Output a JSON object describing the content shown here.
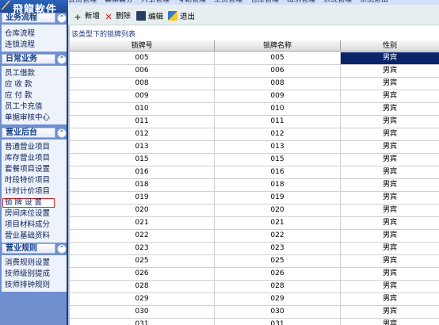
{
  "app": {
    "logo_text": "飛龍軟件"
  },
  "menubar": {
    "items": [
      "会员管理",
      "套票套券",
      "人事管理",
      "考勤管理",
      "工资管理",
      "仓库管理",
      "出纳管理",
      "系统管理",
      "系统退出"
    ]
  },
  "sidebar": {
    "groups": [
      {
        "title": "业务流程",
        "toggle": "⌃",
        "items": [
          "仓库流程",
          "连锁流程"
        ]
      },
      {
        "title": "日常业务",
        "toggle": "⌃",
        "items": [
          "员工借款",
          "应 收 款",
          "应 付 款",
          "员工卡充值",
          "单据审核中心"
        ]
      },
      {
        "title": "营业后台",
        "toggle": "⌃",
        "items": [
          "普通营业项目",
          "库存营业项目",
          "套餐项目设置",
          "时段特价项目",
          "计时计价项目",
          "锁 牌 设 置",
          "房间床位设置",
          "项目材料成分",
          "营业基础资料"
        ]
      },
      {
        "title": "营业规则",
        "toggle": "⌃",
        "items": [
          "消费规则设置",
          "技师级别提成",
          "技师排钟规则"
        ]
      }
    ],
    "selected_item": "锁 牌 设 置"
  },
  "toolbar": {
    "add_label": "新增",
    "delete_label": "删除",
    "edit_label": "编辑",
    "exit_label": "退出"
  },
  "table": {
    "caption": "该类型下的锁牌列表",
    "columns": [
      "锁牌号",
      "锁牌名称",
      "性别"
    ],
    "rows": [
      [
        "005",
        "005",
        "男宾"
      ],
      [
        "006",
        "006",
        "男宾"
      ],
      [
        "008",
        "008",
        "男宾"
      ],
      [
        "009",
        "009",
        "男宾"
      ],
      [
        "010",
        "010",
        "男宾"
      ],
      [
        "011",
        "011",
        "男宾"
      ],
      [
        "012",
        "012",
        "男宾"
      ],
      [
        "013",
        "013",
        "男宾"
      ],
      [
        "015",
        "015",
        "男宾"
      ],
      [
        "016",
        "016",
        "男宾"
      ],
      [
        "018",
        "018",
        "男宾"
      ],
      [
        "019",
        "019",
        "男宾"
      ],
      [
        "020",
        "020",
        "男宾"
      ],
      [
        "021",
        "021",
        "男宾"
      ],
      [
        "022",
        "022",
        "男宾"
      ],
      [
        "023",
        "023",
        "男宾"
      ],
      [
        "025",
        "025",
        "男宾"
      ],
      [
        "026",
        "026",
        "男宾"
      ],
      [
        "028",
        "028",
        "男宾"
      ],
      [
        "029",
        "029",
        "男宾"
      ],
      [
        "030",
        "030",
        "男宾"
      ],
      [
        "031",
        "031",
        "男宾"
      ]
    ],
    "selected_row": 0
  }
}
